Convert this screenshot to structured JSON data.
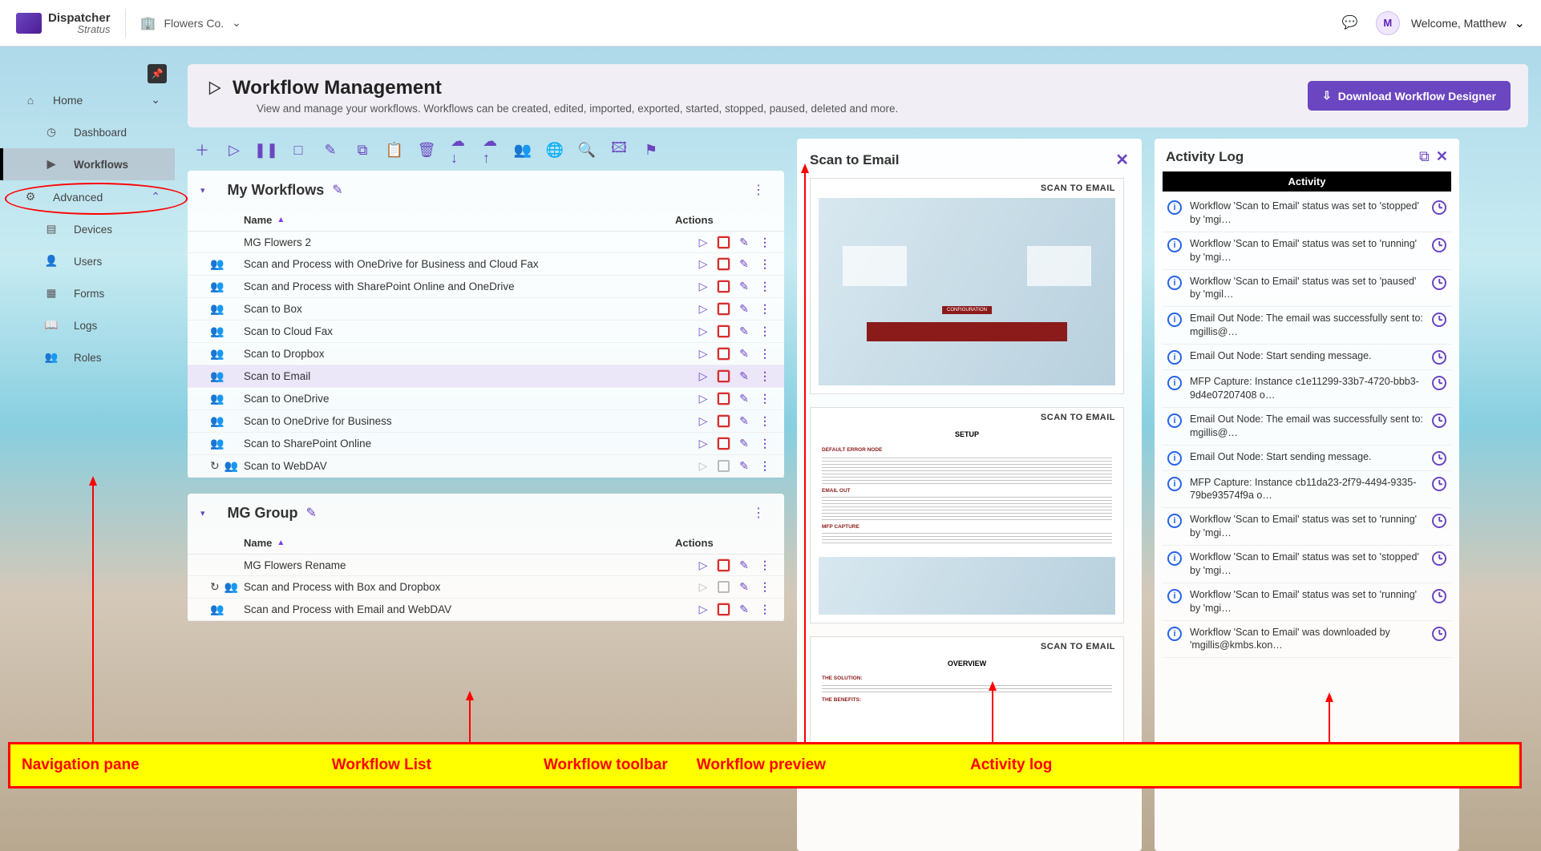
{
  "brand": {
    "main": "Dispatcher",
    "sub": "Stratus"
  },
  "company": "Flowers Co.",
  "user": {
    "initial": "M",
    "welcome": "Welcome, Matthew"
  },
  "sidebar": {
    "home": "Home",
    "dashboard": "Dashboard",
    "workflows": "Workflows",
    "advanced": "Advanced",
    "devices": "Devices",
    "users": "Users",
    "forms": "Forms",
    "logs": "Logs",
    "roles": "Roles"
  },
  "page": {
    "title": "Workflow Management",
    "subtitle": "View and manage your workflows. Workflows can be created, edited, imported, exported, started, stopped, paused, deleted and more.",
    "download_btn": "Download Workflow Designer"
  },
  "wf_groups": [
    {
      "title": "My Workflows",
      "name_col": "Name",
      "actions_col": "Actions",
      "rows": [
        {
          "name": "MG Flowers 2",
          "shared": false,
          "play": true,
          "stop": true
        },
        {
          "name": "Scan and Process with OneDrive for Business and Cloud Fax",
          "shared": true,
          "play": true,
          "stop": true
        },
        {
          "name": "Scan and Process with SharePoint Online and OneDrive",
          "shared": true,
          "play": true,
          "stop": true
        },
        {
          "name": "Scan to Box",
          "shared": true,
          "play": true,
          "stop": true
        },
        {
          "name": "Scan to Cloud Fax",
          "shared": true,
          "play": true,
          "stop": true
        },
        {
          "name": "Scan to Dropbox",
          "shared": true,
          "play": true,
          "stop": true
        },
        {
          "name": "Scan to Email",
          "shared": true,
          "play": true,
          "stop": true,
          "selected": true
        },
        {
          "name": "Scan to OneDrive",
          "shared": true,
          "play": true,
          "stop": true
        },
        {
          "name": "Scan to OneDrive for Business",
          "shared": true,
          "play": true,
          "stop": true
        },
        {
          "name": "Scan to SharePoint Online",
          "shared": true,
          "play": true,
          "stop": true
        },
        {
          "name": "Scan to WebDAV",
          "shared": true,
          "extra_icon": true,
          "play": false,
          "stop": false
        }
      ]
    },
    {
      "title": "MG Group",
      "name_col": "Name",
      "actions_col": "Actions",
      "rows": [
        {
          "name": "MG Flowers Rename",
          "shared": false,
          "play": true,
          "stop": true
        },
        {
          "name": "Scan and Process with Box and Dropbox",
          "shared": true,
          "extra_icon": true,
          "play": false,
          "stop": false
        },
        {
          "name": "Scan and Process with Email and WebDAV",
          "shared": true,
          "play": true,
          "stop": true
        }
      ]
    }
  ],
  "preview": {
    "title": "Scan to Email",
    "page_heading": "SCAN TO EMAIL",
    "setup_label": "SETUP",
    "overview_label": "OVERVIEW",
    "error_node": "DEFAULT ERROR NODE",
    "email_out": "EMAIL OUT",
    "mfp_capture": "MFP CAPTURE",
    "config_label": "CONFIGURATION",
    "solution_label": "THE SOLUTION:",
    "benefits_label": "THE BENEFITS:"
  },
  "activity": {
    "title": "Activity Log",
    "tab": "Activity",
    "items": [
      "Workflow 'Scan to Email' status was set to 'stopped' by 'mgi…",
      "Workflow 'Scan to Email' status was set to 'running' by 'mgi…",
      "Workflow 'Scan to Email' status was set to 'paused' by 'mgil…",
      "Email Out Node: The email was successfully sent to: mgillis@…",
      "Email Out Node: Start sending message.",
      "MFP Capture: Instance c1e11299-33b7-4720-bbb3-9d4e07207408 o…",
      "Email Out Node: The email was successfully sent to: mgillis@…",
      "Email Out Node: Start sending message.",
      "MFP Capture: Instance cb11da23-2f79-4494-9335-79be93574f9a o…",
      "Workflow 'Scan to Email' status was set to 'running' by 'mgi…",
      "Workflow 'Scan to Email' status was set to 'stopped' by 'mgi…",
      "Workflow 'Scan to Email' status was set to 'running' by 'mgi…",
      "Workflow 'Scan to Email' was downloaded by 'mgillis@kmbs.kon…"
    ]
  },
  "annotations": {
    "nav": "Navigation pane",
    "list": "Workflow List",
    "toolbar": "Workflow toolbar",
    "preview": "Workflow preview",
    "log": "Activity log"
  }
}
